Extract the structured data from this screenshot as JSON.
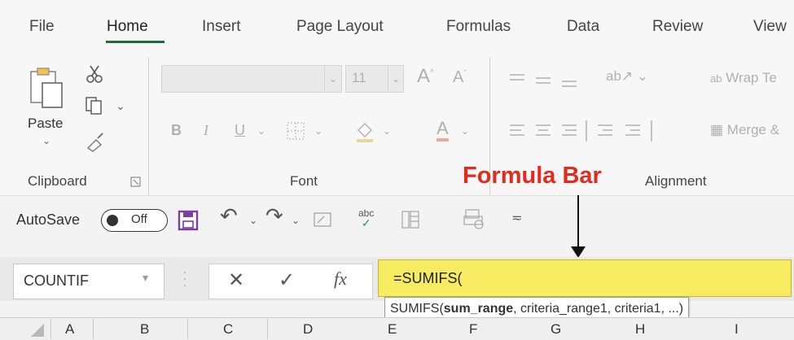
{
  "menu": {
    "tabs": [
      "File",
      "Home",
      "Insert",
      "Page Layout",
      "Formulas",
      "Data",
      "Review",
      "View"
    ],
    "active": "Home"
  },
  "ribbon": {
    "clipboard": {
      "paste_label": "Paste",
      "group_label": "Clipboard"
    },
    "font": {
      "font_size": "11",
      "group_label": "Font",
      "bold": "B",
      "italic": "I",
      "underline": "U",
      "grow": "A",
      "shrink": "A",
      "color_a": "A"
    },
    "alignment": {
      "wrap_text": "Wrap Te",
      "merge": "Merge &",
      "group_label": "Alignment",
      "wrap_icon_text": "ab"
    }
  },
  "annotation": {
    "text": "Formula Bar",
    "color": "#e02b20"
  },
  "quick_access": {
    "autosave_label": "AutoSave",
    "toggle_label": "Off",
    "spell_icon_text": "abc"
  },
  "formula_bar": {
    "name_box_value": "COUNTIF",
    "fx_label": "fx",
    "formula_value": "=SUMIFS(",
    "highlight_color": "#f7ec61",
    "tooltip": {
      "func": "SUMIFS(",
      "bold_arg": "sum_range",
      "rest": ", criteria_range1, criteria1, ...)"
    }
  },
  "columns": [
    "A",
    "B",
    "C",
    "D",
    "E",
    "F",
    "G",
    "H",
    "I"
  ]
}
